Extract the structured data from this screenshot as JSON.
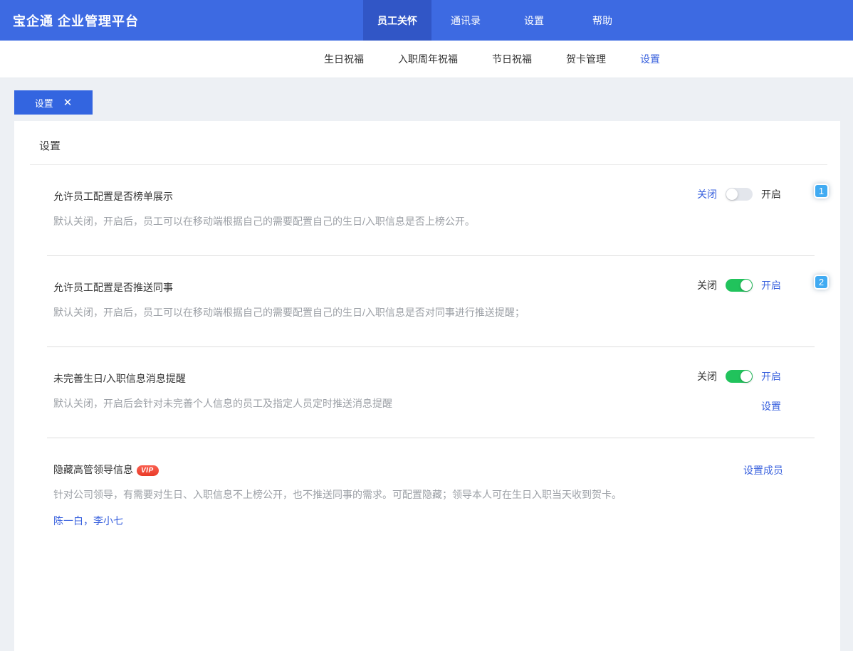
{
  "header": {
    "title": "宝企通 企业管理平台",
    "nav": [
      {
        "label": "员工关怀",
        "state": "active"
      },
      {
        "label": "通讯录",
        "state": "normal"
      },
      {
        "label": "设置",
        "state": "normal"
      },
      {
        "label": "帮助",
        "state": "normal"
      }
    ]
  },
  "subnav": {
    "items": [
      {
        "label": "生日祝福",
        "state": "normal"
      },
      {
        "label": "入职周年祝福",
        "state": "normal"
      },
      {
        "label": "节日祝福",
        "state": "normal"
      },
      {
        "label": "贺卡管理",
        "state": "normal"
      },
      {
        "label": "设置",
        "state": "active"
      }
    ]
  },
  "tab": {
    "label": "设置",
    "close": "✕"
  },
  "panel": {
    "heading": "设置",
    "settings": [
      {
        "title": "允许员工配置是否榜单展示",
        "description": "默认关闭，开启后，员工可以在移动端根据自己的需要配置自己的生日/入职信息是否上榜公开。",
        "off_label": "关闭",
        "on_label": "开启",
        "state": "off",
        "badge": "1"
      },
      {
        "title": "允许员工配置是否推送同事",
        "description": "默认关闭，开启后，员工可以在移动端根据自己的需要配置自己的生日/入职信息是否对同事进行推送提醒；",
        "off_label": "关闭",
        "on_label": "开启",
        "state": "on",
        "badge": "2"
      },
      {
        "title": "未完善生日/入职信息消息提醒",
        "description": "默认关闭，开启后会针对未完善个人信息的员工及指定人员定时推送消息提醒",
        "off_label": "关闭",
        "on_label": "开启",
        "state": "on",
        "link": "设置"
      },
      {
        "title": "隐藏高管领导信息",
        "vip": "VIP",
        "description": "针对公司领导，有需要对生日、入职信息不上榜公开，也不推送同事的需求。可配置隐藏；领导本人可在生日入职当天收到贺卡。",
        "action": "设置成员",
        "members": "陈一白，李小七"
      }
    ]
  },
  "colors": {
    "header_bg": "#3d6ae2",
    "header_active_bg": "#3156c6",
    "accent_blue": "#3a62de",
    "toggle_on_green": "#21c35c",
    "toggle_off_gray": "#e3e6ec",
    "badge_blue": "#41abf2",
    "vip_red": "#e93a27",
    "page_bg": "#edf0f4"
  }
}
